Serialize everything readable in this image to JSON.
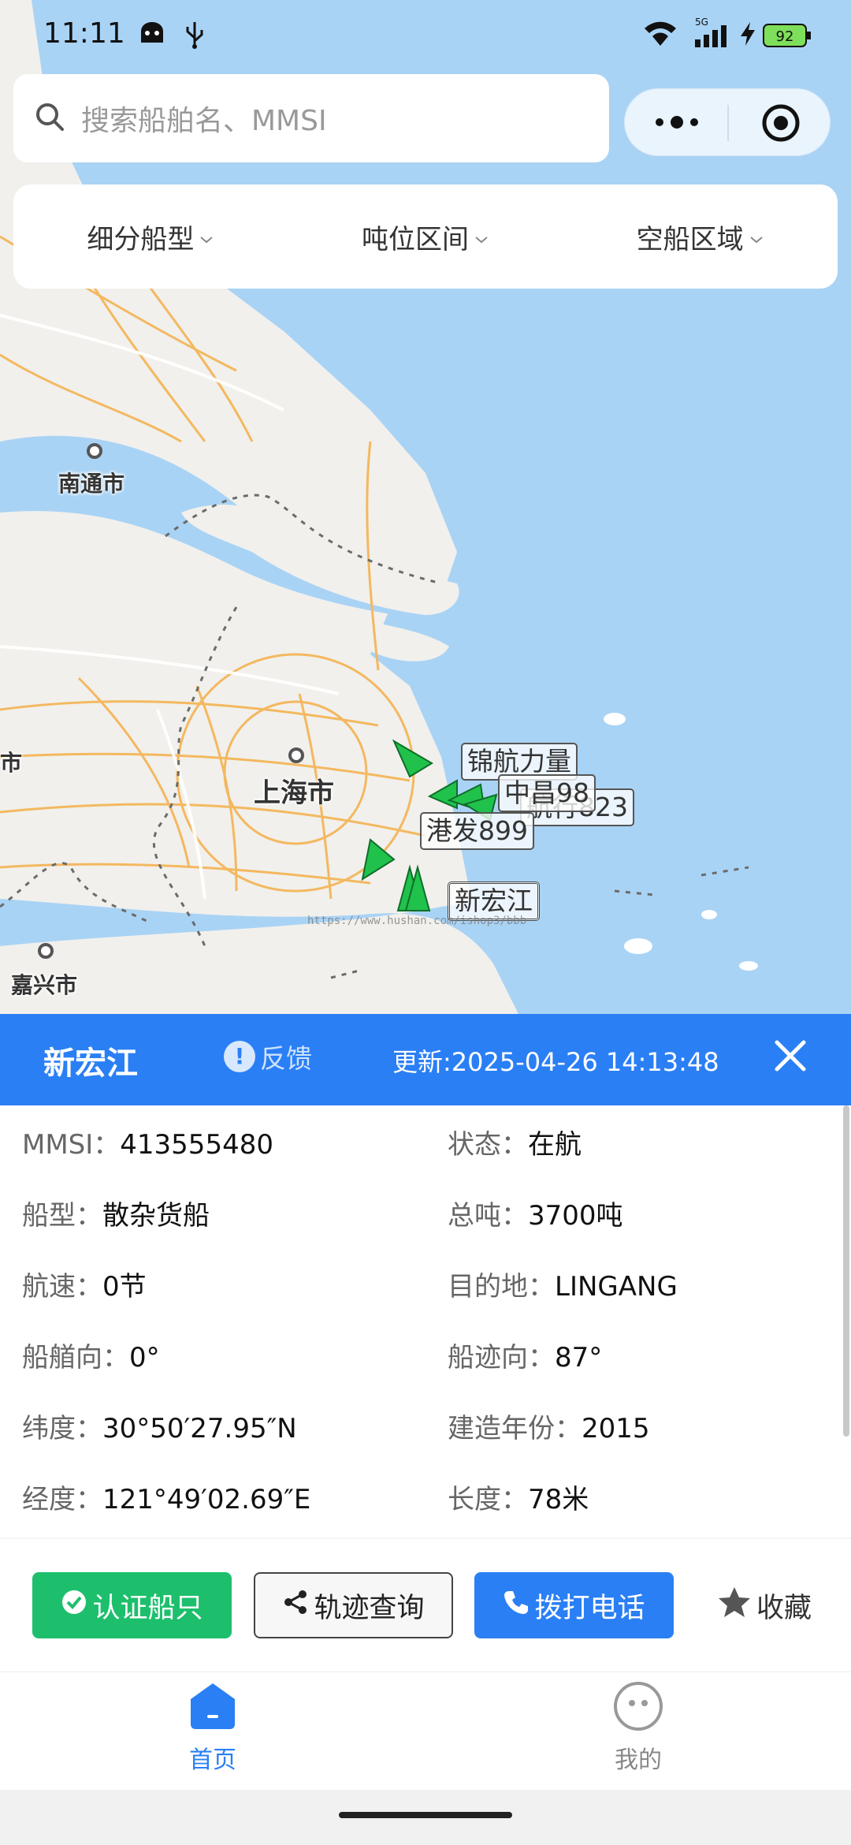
{
  "status_bar": {
    "time": "11:11",
    "battery": "92",
    "network": "5G",
    "icons": [
      "android-icon",
      "usb-icon",
      "wifi-icon",
      "signal-icon",
      "charging-icon",
      "battery-icon"
    ]
  },
  "search": {
    "placeholder": "搜索船舶名、MMSI"
  },
  "capsule": {
    "more_icon": "more-dots-icon",
    "target_icon": "target-icon"
  },
  "filters": {
    "items": [
      {
        "label": "细分船型"
      },
      {
        "label": "吨位区间"
      },
      {
        "label": "空船区域"
      }
    ]
  },
  "map": {
    "cities": [
      "南通市",
      "上海市",
      "嘉兴市",
      "市"
    ],
    "ship_labels": [
      "锦航力量",
      "中昌98",
      "航行823",
      "港发899",
      "新宏江"
    ],
    "watermark": "https://www.hushan.com/ishop3/bbb",
    "colors": {
      "water": "#a9d3f5",
      "land": "#f1f0ec",
      "road": "#f4b860",
      "ship": "#20c24b"
    }
  },
  "panel": {
    "ship_name": "新宏江",
    "feedback_label": "反馈",
    "update_time": "更新:2025-04-26 14:13:48",
    "fields": [
      {
        "key": "MMSI：",
        "value": "413555480"
      },
      {
        "key": "状态：",
        "value": "在航"
      },
      {
        "key": "船型：",
        "value": "散杂货船"
      },
      {
        "key": "总吨：",
        "value": "3700吨"
      },
      {
        "key": "航速：",
        "value": "0节"
      },
      {
        "key": "目的地：",
        "value": "LINGANG"
      },
      {
        "key": "船艏向：",
        "value": "0°"
      },
      {
        "key": "船迹向：",
        "value": "87°"
      },
      {
        "key": "纬度：",
        "value": "30°50′27.95″N"
      },
      {
        "key": "建造年份：",
        "value": "2015"
      },
      {
        "key": "经度：",
        "value": "121°49′02.69″E"
      },
      {
        "key": "长度：",
        "value": "78米"
      }
    ]
  },
  "actions": {
    "verify": "认证船只",
    "track": "轨迹查询",
    "call": "拨打电话",
    "favorite": "收藏"
  },
  "tabs": [
    {
      "label": "首页",
      "active": true
    },
    {
      "label": "我的",
      "active": false
    }
  ]
}
